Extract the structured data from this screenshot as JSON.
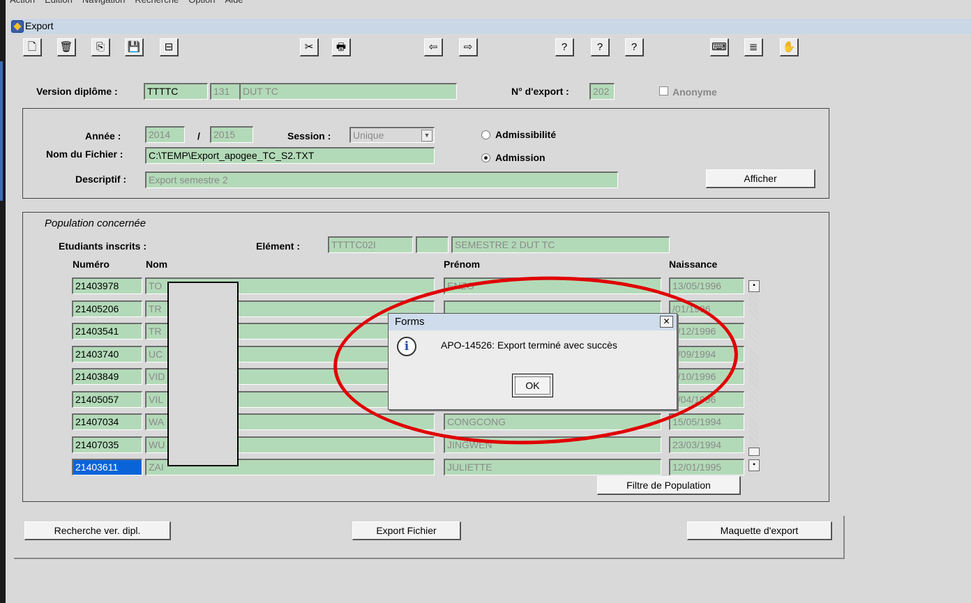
{
  "menubar": [
    "Action",
    "Edition",
    "Navigation",
    "Recherche",
    "Option",
    "Aide"
  ],
  "window": {
    "title": "Export"
  },
  "toolbar": [
    {
      "name": "new-document-icon",
      "glyph": "🗋"
    },
    {
      "name": "delete-icon",
      "glyph": "🗑"
    },
    {
      "name": "copy-icon",
      "glyph": "⎘"
    },
    {
      "name": "save-icon",
      "glyph": "💾"
    },
    {
      "name": "minimize-record-icon",
      "glyph": "⊟"
    },
    {
      "name": "clear-icon",
      "glyph": "✂"
    },
    {
      "name": "print-icon",
      "glyph": "🖶"
    },
    {
      "name": "previous-icon",
      "glyph": "⇦"
    },
    {
      "name": "next-icon",
      "glyph": "⇨"
    },
    {
      "name": "help-icon",
      "glyph": "?"
    },
    {
      "name": "help-context-icon",
      "glyph": "?"
    },
    {
      "name": "help-plus-icon",
      "glyph": "?"
    },
    {
      "name": "keyboard-icon",
      "glyph": "⌨"
    },
    {
      "name": "list-icon",
      "glyph": "≣"
    },
    {
      "name": "hand-icon",
      "glyph": "✋"
    }
  ],
  "header": {
    "version_label": "Version diplôme :",
    "version_code": "TTTTC",
    "version_num": "131",
    "version_name": "DUT TC",
    "export_label": "N° d'export :",
    "export_num": "202",
    "anonyme_label": "Anonyme"
  },
  "params": {
    "annee_label": "Année :",
    "annee_start": "2014",
    "annee_sep": "/",
    "annee_end": "2015",
    "session_label": "Session :",
    "session_value": "Unique",
    "admissibilite": "Admissibilité",
    "admission": "Admission",
    "fichier_label": "Nom du Fichier :",
    "fichier_value": "C:\\TEMP\\Export_apogee_TC_S2.TXT",
    "descriptif_label": "Descriptif :",
    "descriptif_value": "Export semestre 2",
    "afficher": "Afficher"
  },
  "population": {
    "title": "Population concernée",
    "inscrits_label": "Etudiants inscrits :",
    "element_label": "Elément :",
    "element_code": "TTTTC02I",
    "element_extra": "",
    "element_name": "SEMESTRE 2 DUT TC",
    "col_numero": "Numéro",
    "col_nom": "Nom",
    "col_prenom": "Prénom",
    "col_naissance": "Naissance",
    "rows": [
      {
        "numero": "21403978",
        "nom": "TO",
        "prenom": "ENZO",
        "naissance": "13/05/1996"
      },
      {
        "numero": "21405206",
        "nom": "TR",
        "prenom": "",
        "naissance": "/01/1996"
      },
      {
        "numero": "21403541",
        "nom": "TR",
        "prenom": "",
        "naissance": "7/12/1996"
      },
      {
        "numero": "21403740",
        "nom": "UC",
        "prenom": "",
        "naissance": "4/09/1994"
      },
      {
        "numero": "21403849",
        "nom": "VID",
        "prenom": "",
        "naissance": "6/10/1996"
      },
      {
        "numero": "21405057",
        "nom": "VIL",
        "prenom": "",
        "naissance": "9/04/1996"
      },
      {
        "numero": "21407034",
        "nom": "WA",
        "prenom": "CONGCONG",
        "naissance": "15/05/1994"
      },
      {
        "numero": "21407035",
        "nom": "WU",
        "prenom": "JINGWEN",
        "naissance": "23/03/1994"
      },
      {
        "numero": "21403611",
        "nom": "ZAI",
        "prenom": "JULIETTE",
        "naissance": "12/01/1995"
      }
    ],
    "filtre": "Filtre de Population"
  },
  "bottom": {
    "recherche": "Recherche ver. dipl.",
    "export": "Export Fichier",
    "maquette": "Maquette d'export"
  },
  "dialog": {
    "title": "Forms",
    "close": "✕",
    "message": "APO-14526: Export terminé avec succès",
    "ok": "OK"
  },
  "colors": {
    "field": "#b3dab8",
    "highlight": "#e00000",
    "selected": "#0a64d8"
  }
}
